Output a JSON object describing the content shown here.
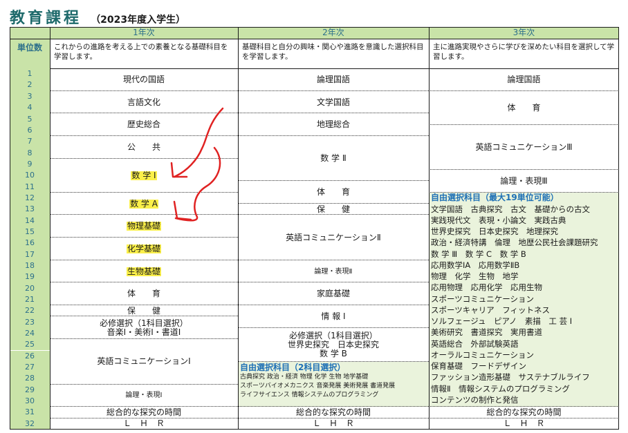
{
  "title": {
    "main": "教育課程",
    "sub": "（2023年度入学生）"
  },
  "header": {
    "unit": "単位数",
    "years": [
      "1年次",
      "2年次",
      "3年次"
    ],
    "desc": [
      "これからの進路を考える上での素養となる基礎科目を学習します。",
      "基礎科目と自分の興味・関心や進路を意識した選択科目を学習します。",
      "主に進路実現やさらに学びを深めたい科目を選択して学習します。"
    ]
  },
  "units": [
    "1",
    "2",
    "3",
    "4",
    "5",
    "6",
    "7",
    "8",
    "9",
    "10",
    "11",
    "12",
    "13",
    "14",
    "15",
    "16",
    "17",
    "18",
    "19",
    "20",
    "21",
    "22",
    "23",
    "24",
    "25",
    "26",
    "27",
    "28",
    "29",
    "30",
    "31",
    "32"
  ],
  "year1": [
    {
      "label": "現代の国語",
      "start": 1,
      "end": 2
    },
    {
      "label": "言語文化",
      "start": 3,
      "end": 4
    },
    {
      "label": "歴史総合",
      "start": 5,
      "end": 6
    },
    {
      "label": "公　　共",
      "start": 7,
      "end": 8
    },
    {
      "label": "数 学 Ⅰ",
      "start": 9,
      "end": 11,
      "highlight": true
    },
    {
      "label": "数 学 A",
      "start": 12,
      "end": 13,
      "highlight": true
    },
    {
      "label": "物理基礎",
      "start": 14,
      "end": 15,
      "highlight": true
    },
    {
      "label": "化学基礎",
      "start": 16,
      "end": 17,
      "highlight": true
    },
    {
      "label": "生物基礎",
      "start": 18,
      "end": 19,
      "highlight": true
    },
    {
      "label": "体　　育",
      "start": 20,
      "end": 21
    },
    {
      "label": "保　　健",
      "start": 22,
      "end": 22
    },
    {
      "label": "必修選択（1科目選択）\n音楽Ⅰ・美術Ⅰ・書道Ⅰ",
      "start": 23,
      "end": 24
    },
    {
      "label": "英語コミュニケーションⅠ",
      "start": 25,
      "end": 28
    },
    {
      "label": "論理・表現Ⅰ",
      "start": 29,
      "end": 30,
      "small": true
    },
    {
      "label": "総合的な探究の時間",
      "start": 31,
      "end": 31
    },
    {
      "label": "Ｌ　Ｈ　Ｒ",
      "start": 32,
      "end": 32
    }
  ],
  "year2": [
    {
      "label": "論理国語",
      "start": 1,
      "end": 2
    },
    {
      "label": "文学国語",
      "start": 3,
      "end": 4
    },
    {
      "label": "地理総合",
      "start": 5,
      "end": 6
    },
    {
      "label": "数 学 Ⅱ",
      "start": 7,
      "end": 10
    },
    {
      "label": "体　　育",
      "start": 11,
      "end": 12
    },
    {
      "label": "保　　健",
      "start": 13,
      "end": 13
    },
    {
      "label": "英語コミュニケーションⅡ",
      "start": 14,
      "end": 17
    },
    {
      "label": "論理・表現Ⅱ",
      "start": 18,
      "end": 19,
      "small": true
    },
    {
      "label": "家庭基礎",
      "start": 20,
      "end": 21
    },
    {
      "label": "情 報 Ⅰ",
      "start": 22,
      "end": 23
    },
    {
      "label": "必修選択（1科目選択）\n世界史探究　日本史探究\n数 学 B",
      "start": 24,
      "end": 26
    },
    {
      "label": "総合的な探究の時間",
      "start": 31,
      "end": 31
    },
    {
      "label": "Ｌ　Ｈ　Ｒ",
      "start": 32,
      "end": 32
    }
  ],
  "year2_elective": {
    "title": "自由選択科目（2科目選択）",
    "lines": [
      "古典探究 政治・経済 物理 化学 生物 地学基礎",
      "スポーツバイオメカニクス 音楽発展 美術発展 書道発展",
      "ライフサイエンス 情報システムのプログラミング"
    ]
  },
  "year3": [
    {
      "label": "論理国語",
      "start": 1,
      "end": 2
    },
    {
      "label": "体　　育",
      "start": 3,
      "end": 5
    },
    {
      "label": "英語コミュニケーションⅢ",
      "start": 6,
      "end": 9
    },
    {
      "label": "論理・表現Ⅲ",
      "start": 10,
      "end": 11
    },
    {
      "label": "総合的な探究の時間",
      "start": 31,
      "end": 31
    },
    {
      "label": "Ｌ　Ｈ　Ｒ",
      "start": 32,
      "end": 32
    }
  ],
  "year3_elective": {
    "title": "自由選択科目（最大19単位可能）",
    "lines": [
      "文学国語　古典探究　古文　基礎からの古文",
      "実践現代文　表現・小論文　実践古典",
      "世界史探究　日本史探究　地理探究",
      "政治・経済特講　倫理　地歴公民社会課題研究",
      "数 学 Ⅲ　数 学 C　数 学 B",
      "応用数学ⅠA　応用数学ⅡB",
      "物理　化学　生物　地学",
      "応用物理　応用化学　応用生物",
      "スポーツコミュニケーション",
      "スポーツキャリア　フィットネス",
      "ソルフェージュ　ピアノ　素描　工 芸 Ⅰ",
      "美術研究　書道探究　実用書道",
      "英語総合　外部試験英語",
      "オーラルコミュニケーション",
      "保育基礎　フードデザイン",
      "ファッション造形基礎　サステナブルライフ",
      "情報Ⅱ　情報システムのプログラミング",
      "コンテンツの制作と発信"
    ]
  },
  "colors": {
    "title": "#1e6a6b",
    "header_bg": "#c9e3a8",
    "header_text": "#2b6f8a",
    "elective_bg": "#eaf3dc",
    "elective_title": "#1d6fb5",
    "highlight": "#fbf04a",
    "annotation": "#e02222"
  }
}
